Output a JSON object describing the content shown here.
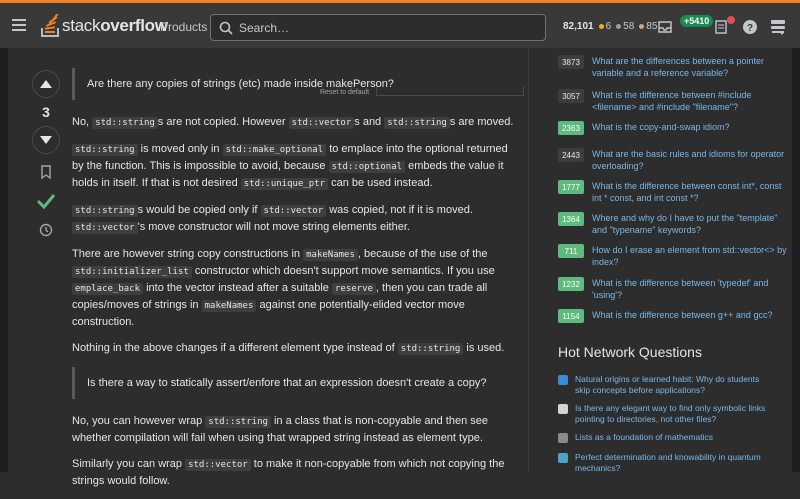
{
  "topbar": {
    "logo_prefix": "stack",
    "logo_suffix": "overflow",
    "products_label": "Products",
    "search_placeholder": "Search…",
    "reputation": "82,101",
    "gold": "6",
    "silver": "58",
    "bronze": "85",
    "rep_change": "+5410",
    "colors": {
      "gold": "#f1b600",
      "silver": "#9a9fa4",
      "bronze": "#d1a684",
      "accent": "#f48225"
    }
  },
  "post": {
    "reset_label": "Reset to default",
    "vote_count": "3",
    "quote1": "Are there any copies of strings (etc) made inside makePerson?",
    "p1": {
      "t1": "No, ",
      "c1": "std::string",
      "t2": "s are not copied. However ",
      "c2": "std::vector",
      "t3": "s and ",
      "c3": "std::string",
      "t4": "s are moved."
    },
    "p2": {
      "c1": "std::string",
      "t1": " is moved only in ",
      "c2": "std::make_optional",
      "t2": " to emplace into the optional returned by the function. This is impossible to avoid, because ",
      "c3": "std::optional",
      "t3": " embeds the value it holds in itself. If that is not desired ",
      "c4": "std::unique_ptr",
      "t4": " can be used instead."
    },
    "p3": {
      "c1": "std::string",
      "t1": "s would be copied only if ",
      "c2": "std::vector",
      "t2": " was copied, not if it is moved. ",
      "c3": "std::vector",
      "t3": "'s move constructor will not move string elements either."
    },
    "p4": {
      "t1": "There are however string copy constructions in ",
      "c1": "makeNames",
      "t2": ", because of the use of the ",
      "c2": "std::initializer_list",
      "t3": " constructor which doesn't support move semantics. If you use ",
      "c3": "emplace_back",
      "t4": " into the vector instead after a suitable ",
      "c4": "reserve",
      "t5": ", then you can trade all copies/moves of strings in ",
      "c5": "makeNames",
      "t6": " against one potentially-elided vector move construction."
    },
    "p5": {
      "t1": "Nothing in the above changes if a different element type instead of ",
      "c1": "std::string",
      "t2": " is used."
    },
    "quote2": "Is there a way to statically assert/enfore that an expression doesn't create a copy?",
    "p6": {
      "t1": "No, you can however wrap ",
      "c1": "std::string",
      "t2": " in a class that is non-copyable and then see whether compilation will fail when using that wrapped string instead as element type."
    },
    "p7": {
      "t1": "Similarly you can wrap ",
      "c1": "std::vector",
      "t2": " to make it non-copyable from which not copying the strings would follow."
    }
  },
  "linked": [
    {
      "score": "3873",
      "accepted": false,
      "title": "What are the differences between a pointer variable and a reference variable?"
    },
    {
      "score": "3057",
      "accepted": false,
      "title": "What is the difference between #include <filename> and #include \"filename\"?"
    },
    {
      "score": "2363",
      "accepted": true,
      "title": "What is the copy-and-swap idiom?"
    },
    {
      "score": "2443",
      "accepted": false,
      "title": "What are the basic rules and idioms for operator overloading?"
    },
    {
      "score": "1777",
      "accepted": true,
      "title": "What is the difference between const int*, const int * const, and int const *?"
    },
    {
      "score": "1364",
      "accepted": true,
      "title": "Where and why do I have to put the \"template\" and \"typename\" keywords?"
    },
    {
      "score": "711",
      "accepted": true,
      "title": "How do I erase an element from std::vector<> by index?"
    },
    {
      "score": "1232",
      "accepted": true,
      "title": "What is the difference between 'typedef' and 'using'?"
    },
    {
      "score": "1154",
      "accepted": true,
      "title": "What is the difference between g++ and gcc?"
    }
  ],
  "hnq": {
    "title": "Hot Network Questions",
    "items": [
      {
        "site_icon": "english-site-icon",
        "color": "#3c8bd6",
        "title": "Natural origins or learned habit: Why do students skip concepts before applications?"
      },
      {
        "site_icon": "unix-site-icon",
        "color": "#d4d4d4",
        "title": "Is there any elegant way to find only symbolic links pointing to directories, not other files?"
      },
      {
        "site_icon": "math-site-icon",
        "color": "#8a8a8a",
        "title": "Lists as a foundation of mathematics"
      },
      {
        "site_icon": "physics-site-icon",
        "color": "#4aa3c8",
        "title": "Perfect determination and knowability in quantum mechanics?"
      }
    ]
  }
}
